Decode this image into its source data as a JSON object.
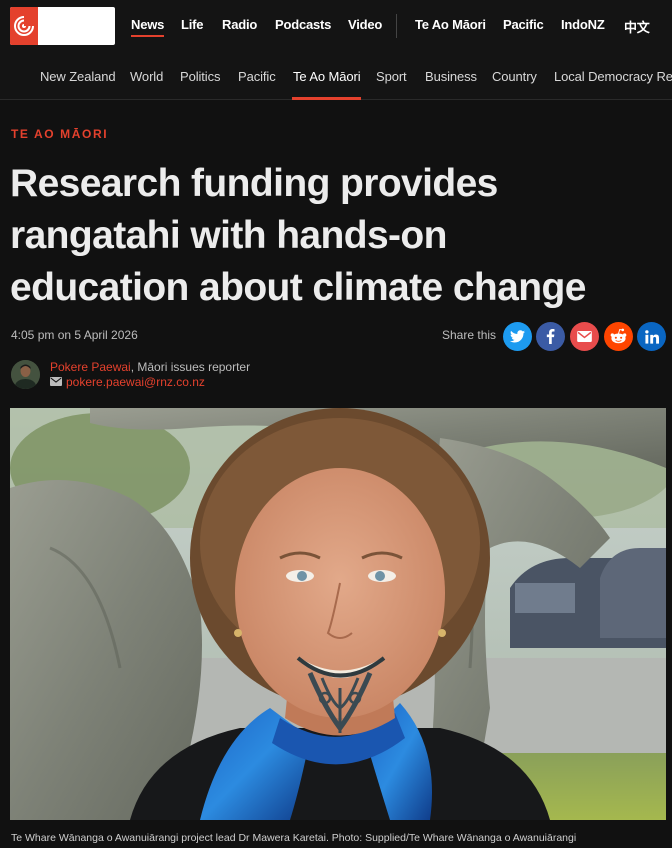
{
  "brand": {
    "logo_icon": "rnz-logo-icon",
    "accent_color": "#e4412d"
  },
  "top_nav": {
    "items": [
      {
        "label": "News",
        "active": true
      },
      {
        "label": "Life"
      },
      {
        "label": "Radio"
      },
      {
        "label": "Podcasts"
      },
      {
        "label": "Video"
      },
      {
        "label": "Te Ao Māori"
      },
      {
        "label": "Pacific"
      },
      {
        "label": "IndoNZ"
      },
      {
        "label": "中文"
      }
    ]
  },
  "section_nav": {
    "items": [
      {
        "label": "New Zealand"
      },
      {
        "label": "World"
      },
      {
        "label": "Politics"
      },
      {
        "label": "Pacific"
      },
      {
        "label": "Te Ao Māori",
        "active": true
      },
      {
        "label": "Sport"
      },
      {
        "label": "Business"
      },
      {
        "label": "Country"
      },
      {
        "label": "Local Democracy Re"
      }
    ]
  },
  "article": {
    "kicker": "TE AO MĀORI",
    "headline_lines": [
      "Research funding provides",
      "rangatahi with hands-on",
      "education about climate change"
    ],
    "timestamp_time": "4:05 pm",
    "timestamp_on": " on ",
    "timestamp_date": "5 April 2026",
    "share_label": "Share this",
    "share_icons": [
      "twitter-icon",
      "facebook-icon",
      "email-icon",
      "reddit-icon",
      "linkedin-icon"
    ],
    "author": {
      "name": "Pokere Paewai",
      "role": ", Māori issues reporter",
      "email": "pokere.paewai@rnz.co.nz"
    },
    "caption": "Te Whare Wānanga o Awanuiārangi project lead Dr Mawera Karetai. Photo: Supplied/Te Whare Wānanga o Awanuiārangi"
  }
}
